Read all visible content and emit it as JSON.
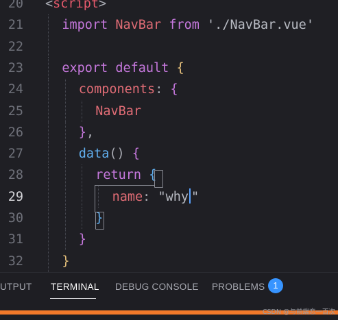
{
  "editor": {
    "active_line": "29",
    "lines": [
      {
        "num": "20",
        "parts": [
          [
            "punct",
            "<"
          ],
          [
            "tag",
            "script"
          ],
          [
            "punct",
            ">"
          ]
        ]
      },
      {
        "num": "21",
        "parts": [
          [
            "kw",
            "import"
          ],
          [
            "plain",
            " "
          ],
          [
            "id",
            "NavBar"
          ],
          [
            "plain",
            " "
          ],
          [
            "kw",
            "from"
          ],
          [
            "plain",
            " "
          ],
          [
            "str",
            "'./NavBar.vue'"
          ]
        ]
      },
      {
        "num": "22",
        "parts": []
      },
      {
        "num": "23",
        "parts": [
          [
            "kw",
            "export"
          ],
          [
            "plain",
            " "
          ],
          [
            "kw",
            "default"
          ],
          [
            "plain",
            " "
          ],
          [
            "brace",
            "{"
          ]
        ]
      },
      {
        "num": "24",
        "parts": [
          [
            "prop",
            "components"
          ],
          [
            "punct",
            ":"
          ],
          [
            "plain",
            " "
          ],
          [
            "brace2",
            "{"
          ]
        ]
      },
      {
        "num": "25",
        "parts": [
          [
            "id",
            "NavBar"
          ]
        ]
      },
      {
        "num": "26",
        "parts": [
          [
            "brace2",
            "}"
          ],
          [
            "punct",
            ","
          ]
        ]
      },
      {
        "num": "27",
        "parts": [
          [
            "fn",
            "data"
          ],
          [
            "punct",
            "()"
          ],
          [
            "plain",
            " "
          ],
          [
            "brace2",
            "{"
          ]
        ]
      },
      {
        "num": "28",
        "parts": [
          [
            "kw",
            "return"
          ],
          [
            "plain",
            " "
          ],
          [
            "fn",
            "{"
          ]
        ]
      },
      {
        "num": "29",
        "parts": [
          [
            "prop",
            "name"
          ],
          [
            "punct",
            ":"
          ],
          [
            "plain",
            " "
          ],
          [
            "str",
            "\"why"
          ],
          [
            "cursor",
            ""
          ],
          [
            "str",
            "\""
          ]
        ]
      },
      {
        "num": "30",
        "parts": [
          [
            "fn",
            "}"
          ]
        ]
      },
      {
        "num": "31",
        "parts": [
          [
            "brace2",
            "}"
          ]
        ]
      },
      {
        "num": "32",
        "parts": [
          [
            "brace",
            "}"
          ]
        ]
      }
    ]
  },
  "panel": {
    "tabs": [
      {
        "label": "UTPUT",
        "active": false
      },
      {
        "label": "TERMINAL",
        "active": true
      },
      {
        "label": "DEBUG CONSOLE",
        "active": false
      },
      {
        "label": "PROBLEMS",
        "active": false
      }
    ],
    "problems_count": "1"
  },
  "watermark": "CSDN @与前端恋一百次",
  "colors": {
    "accent": "#3794ff",
    "statusbar": "#f2792a"
  }
}
